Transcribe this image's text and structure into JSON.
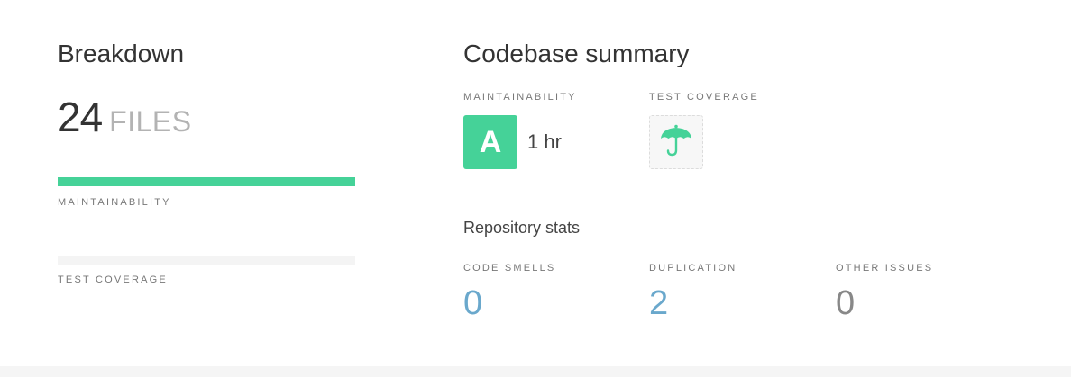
{
  "breakdown": {
    "title": "Breakdown",
    "file_count": "24",
    "file_unit": "FILES",
    "maintainability_label": "MAINTAINABILITY",
    "maintainability_fill": 1.0,
    "coverage_label": "TEST COVERAGE",
    "coverage_fill": 0.0
  },
  "summary": {
    "title": "Codebase summary",
    "maintainability_label": "MAINTAINABILITY",
    "grade": "A",
    "grade_time": "1 hr",
    "coverage_label": "TEST COVERAGE",
    "coverage_icon": "umbrella-icon"
  },
  "repo_stats": {
    "title": "Repository stats",
    "stats": [
      {
        "label": "CODE SMELLS",
        "value": "0"
      },
      {
        "label": "DUPLICATION",
        "value": "2"
      },
      {
        "label": "OTHER ISSUES",
        "value": "0"
      }
    ]
  },
  "colors": {
    "accent_green": "#45d298",
    "stat_blue": "#6aa8cc",
    "stat_grey": "#888888"
  }
}
